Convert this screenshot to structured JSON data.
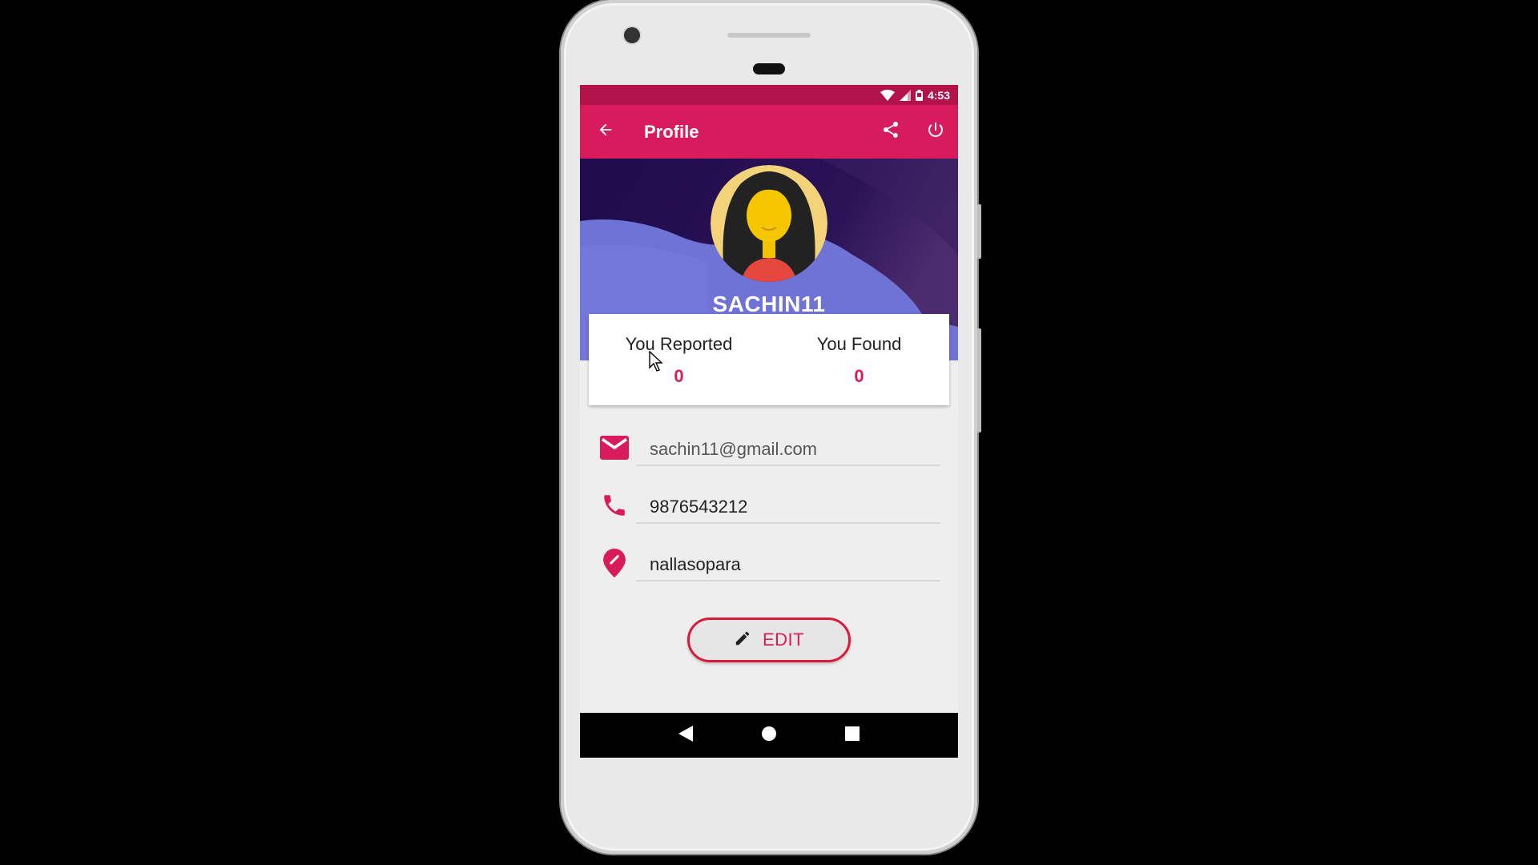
{
  "status_bar": {
    "time": "4:53",
    "icons": [
      "wifi-icon",
      "signal-icon",
      "battery-icon"
    ]
  },
  "app_bar": {
    "title": "Profile",
    "back_icon": "arrow-back-icon",
    "share_icon": "share-icon",
    "power_icon": "power-icon"
  },
  "profile": {
    "username": "SACHIN11",
    "avatar": "female-avatar"
  },
  "stats": {
    "reported_label": "You Reported",
    "reported_value": "0",
    "found_label": "You Found",
    "found_value": "0"
  },
  "fields": {
    "email": "sachin11@gmail.com",
    "phone": "9876543212",
    "location": "nallasopara"
  },
  "actions": {
    "edit_label": "EDIT"
  },
  "colors": {
    "primary": "#d81b5c",
    "status_bar": "#b1134a",
    "hero_dark": "#1f0b4d",
    "hero_wave": "#6f73d6"
  },
  "nav": {
    "back": "back-triangle-icon",
    "home": "home-circle-icon",
    "recents": "recents-square-icon"
  }
}
